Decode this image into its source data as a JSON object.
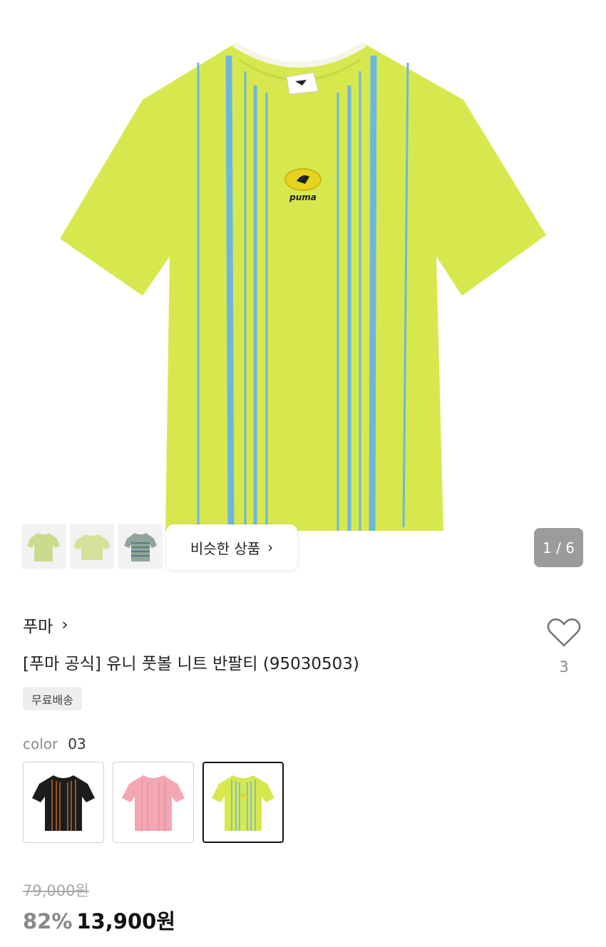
{
  "gallery": {
    "similar_label": "비슷한 상품",
    "counter": "1 / 6",
    "product_logo": "puma"
  },
  "product": {
    "brand": "푸마",
    "title": "[푸마 공식] 유니 풋볼 니트 반팔티 (95030503)",
    "badge": "무료배송",
    "likes": "3"
  },
  "color": {
    "label": "color",
    "value": "03",
    "options": [
      {
        "name": "black",
        "body": "#1c1c1c",
        "stripe": "#b5652d"
      },
      {
        "name": "pink",
        "body": "#f2a7b3",
        "stripe": "#e88ea0"
      },
      {
        "name": "lime",
        "body": "#d7e84f",
        "stripe": "#6fb6dc"
      }
    ]
  },
  "pricing": {
    "original": "79,000원",
    "discount": "82%",
    "price": "13,900원"
  },
  "colors": {
    "shirt_body": "#d7e84f",
    "stripe": "#6fb6dc",
    "counter_bg": "#9b9b9b"
  }
}
